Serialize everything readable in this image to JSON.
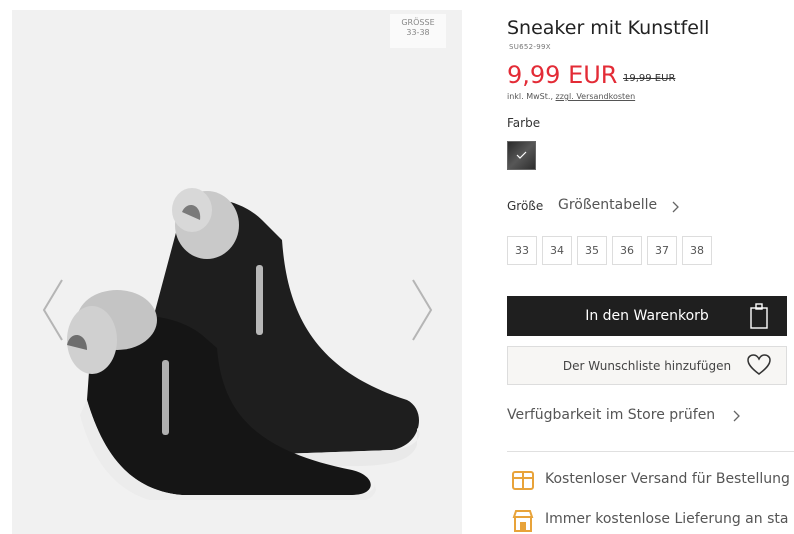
{
  "gallery": {
    "size_badge": {
      "line1": "GRÖSSE",
      "line2": "33-38"
    },
    "prev_icon": "chevron-left-icon",
    "next_icon": "chevron-right-icon"
  },
  "product": {
    "title": "Sneaker mit Kunstfell",
    "sku": "SU652-99X",
    "price": "9,99 EUR",
    "old_price": "19,99 EUR",
    "tax_prefix": "inkl. MwSt.,",
    "shipping_link": "zzgl. Versandkosten",
    "price_color": "#e32b36"
  },
  "color": {
    "label": "Farbe",
    "selected_icon": "check-icon"
  },
  "size": {
    "label": "Größe",
    "chart_link": "Größentabelle",
    "options": [
      "33",
      "34",
      "35",
      "36",
      "37",
      "38"
    ]
  },
  "actions": {
    "add_to_cart": "In den Warenkorb",
    "add_to_cart_icon": "shopping-bag-icon",
    "wishlist": "Der Wunschliste hinzufügen",
    "wishlist_icon": "heart-icon",
    "store_availability": "Verfügbarkeit im Store prüfen"
  },
  "benefits": [
    {
      "icon": "package-icon",
      "text": "Kostenloser Versand für Bestellung"
    },
    {
      "icon": "store-icon",
      "text": "Immer kostenlose Lieferung an sta"
    }
  ],
  "accent_color": "#e8a33a"
}
